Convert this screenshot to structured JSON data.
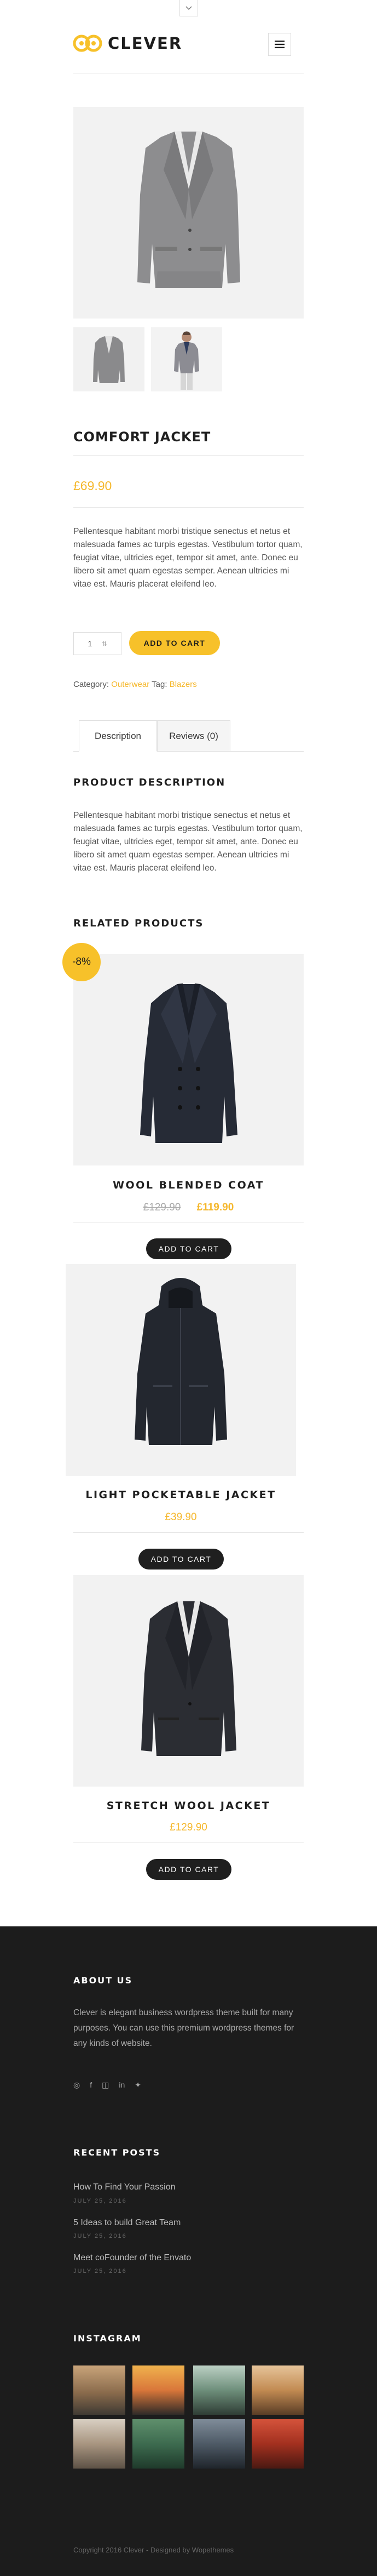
{
  "header": {
    "logo_text": "CLEVER",
    "menu_icon": "hamburger-icon",
    "toggle_icon": "chevron-down-icon"
  },
  "product": {
    "title": "COMFORT JACKET",
    "price": "£69.90",
    "short_description": "Pellentesque habitant morbi tristique senectus et netus et malesuada fames ac turpis egestas. Vestibulum tortor quam, feugiat vitae, ultricies eget, tempor sit amet, ante. Donec eu libero sit amet quam egestas semper. Aenean ultricies mi vitae est. Mauris placerat eleifend leo.",
    "quantity": "1",
    "add_to_cart_label": "ADD TO CART",
    "category_label": "Category:",
    "category_value": "Outerwear",
    "tag_label": "Tag:",
    "tag_value": "Blazers"
  },
  "tabs": {
    "description": "Description",
    "reviews": "Reviews (0)"
  },
  "description_section": {
    "title": "PRODUCT DESCRIPTION",
    "text": "Pellentesque habitant morbi tristique senectus et netus et malesuada fames ac turpis egestas. Vestibulum tortor quam, feugiat vitae, ultricies eget, tempor sit amet, ante. Donec eu libero sit amet quam egestas semper. Aenean ultricies mi vitae est. Mauris placerat eleifend leo."
  },
  "related": {
    "title": "RELATED PRODUCTS",
    "items": [
      {
        "name": "WOOL BLENDED COAT",
        "old_price": "£129.90",
        "price": "£119.90",
        "badge": "-8%",
        "button": "ADD TO CART"
      },
      {
        "name": "LIGHT POCKETABLE JACKET",
        "price": "£39.90",
        "button": "ADD TO CART"
      },
      {
        "name": "STRETCH WOOL JACKET",
        "price": "£129.90",
        "button": "ADD TO CART"
      }
    ]
  },
  "footer": {
    "about_title": "ABOUT US",
    "about_text": "Clever is elegant business wordpress theme built for many purposes. You can use this premium wordpress themes for any kinds of website.",
    "social_icons": [
      "dribbble-icon",
      "facebook-icon",
      "instagram-icon",
      "linkedin-icon",
      "twitter-icon"
    ],
    "recent_title": "RECENT POSTS",
    "posts": [
      {
        "title": "How To Find Your Passion",
        "date": "JULY 25, 2016"
      },
      {
        "title": "5 Ideas to build Great Team",
        "date": "JULY 25, 2016"
      },
      {
        "title": "Meet coFounder of the Envato",
        "date": "JULY 25, 2016"
      }
    ],
    "instagram_title": "INSTAGRAM",
    "copyright": "Copyright 2016 Clever - Designed by Wopethemes"
  },
  "colors": {
    "accent": "#f7c12a",
    "price": "#f5b82e",
    "dark": "#1f1f1f",
    "footer_bg": "#1c1c1c"
  }
}
